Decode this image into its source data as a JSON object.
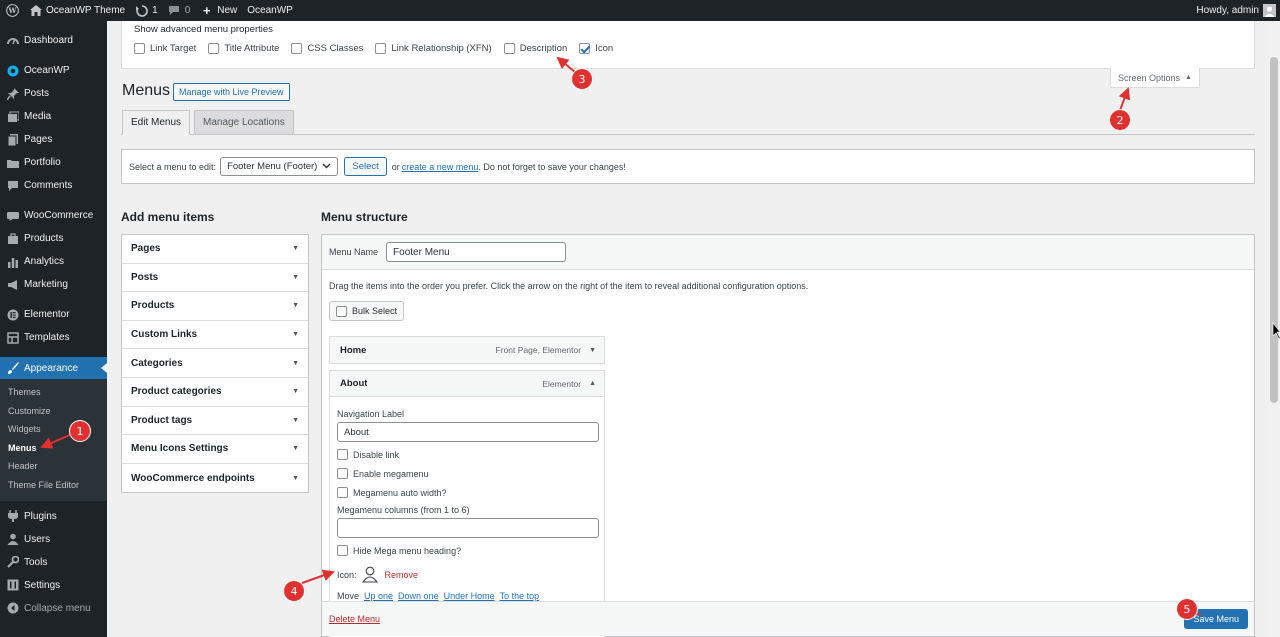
{
  "adminbar": {
    "site_name": "OceanWP Theme",
    "updates_count": "1",
    "comments_count": "0",
    "new_label": "New",
    "oceanwp_label": "OceanWP",
    "howdy": "Howdy, admin"
  },
  "sidebar": {
    "items": [
      {
        "label": "Dashboard",
        "icon": "dashboard-icon"
      },
      {
        "label": "OceanWP",
        "icon": "oceanwp-icon"
      },
      {
        "label": "Posts",
        "icon": "pin-icon"
      },
      {
        "label": "Media",
        "icon": "media-icon"
      },
      {
        "label": "Pages",
        "icon": "pages-icon"
      },
      {
        "label": "Portfolio",
        "icon": "portfolio-icon"
      },
      {
        "label": "Comments",
        "icon": "comments-icon"
      },
      {
        "label": "WooCommerce",
        "icon": "woocommerce-icon"
      },
      {
        "label": "Products",
        "icon": "products-icon"
      },
      {
        "label": "Analytics",
        "icon": "analytics-icon"
      },
      {
        "label": "Marketing",
        "icon": "megaphone-icon"
      },
      {
        "label": "Elementor",
        "icon": "elementor-icon"
      },
      {
        "label": "Templates",
        "icon": "templates-icon"
      },
      {
        "label": "Appearance",
        "icon": "brush-icon"
      },
      {
        "label": "Plugins",
        "icon": "plugins-icon"
      },
      {
        "label": "Users",
        "icon": "users-icon"
      },
      {
        "label": "Tools",
        "icon": "tools-icon"
      },
      {
        "label": "Settings",
        "icon": "settings-icon"
      },
      {
        "label": "Collapse menu",
        "icon": "collapse-icon"
      }
    ],
    "appearance_submenu": [
      "Themes",
      "Customize",
      "Widgets",
      "Menus",
      "Header",
      "Theme File Editor"
    ]
  },
  "screen_options": {
    "title": "Show advanced menu properties",
    "checkboxes": [
      {
        "label": "Link Target",
        "checked": false
      },
      {
        "label": "Title Attribute",
        "checked": false
      },
      {
        "label": "CSS Classes",
        "checked": false
      },
      {
        "label": "Link Relationship (XFN)",
        "checked": false
      },
      {
        "label": "Description",
        "checked": false
      },
      {
        "label": "Icon",
        "checked": true
      }
    ],
    "toggle_label": "Screen Options"
  },
  "page": {
    "title": "Menus",
    "live_preview": "Manage with Live Preview",
    "tabs": [
      "Edit Menus",
      "Manage Locations"
    ]
  },
  "select_bar": {
    "label": "Select a menu to edit:",
    "selected": "Footer Menu (Footer)",
    "select_button": "Select",
    "or": "or",
    "create_link": "create a new menu",
    "suffix": ". Do not forget to save your changes!"
  },
  "add_items": {
    "heading": "Add menu items",
    "sections": [
      "Pages",
      "Posts",
      "Products",
      "Custom Links",
      "Categories",
      "Product categories",
      "Product tags",
      "Menu Icons Settings",
      "WooCommerce endpoints"
    ]
  },
  "structure": {
    "heading": "Menu structure",
    "menu_name_label": "Menu Name",
    "menu_name_value": "Footer Menu",
    "drag_help": "Drag the items into the order you prefer. Click the arrow on the right of the item to reveal additional configuration options.",
    "bulk_select": "Bulk Select",
    "items": [
      {
        "title": "Home",
        "meta": "Front Page, Elementor"
      },
      {
        "title": "About",
        "meta": "Elementor"
      }
    ],
    "about_settings": {
      "nav_label_title": "Navigation Label",
      "nav_label_value": "About",
      "disable_link": "Disable link",
      "enable_megamenu": "Enable megamenu",
      "megamenu_auto_width": "Megamenu auto width?",
      "megamenu_columns": "Megamenu columns (from 1 to 6)",
      "hide_heading": "Hide Mega menu heading?",
      "icon_label": "Icon:",
      "remove": "Remove",
      "move_label": "Move",
      "move_links": [
        "Up one",
        "Down one",
        "Under Home",
        "To the top"
      ]
    },
    "delete_menu": "Delete Menu",
    "save_menu": "Save Menu"
  },
  "annotations": [
    "1",
    "2",
    "3",
    "4",
    "5"
  ],
  "colors": {
    "accent": "#2271b1",
    "sidebar_bg": "#1d2327",
    "annotation_red": "#e03131"
  }
}
